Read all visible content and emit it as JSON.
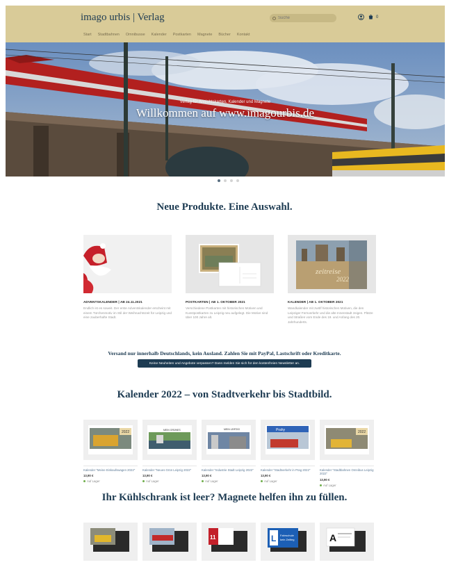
{
  "header": {
    "brand": "imago urbis | Verlag",
    "search_placeholder": "Suche",
    "user_icon": "user-icon",
    "cart_icon": "cart-icon",
    "cart_count": "0",
    "nav": [
      "Start",
      "Stadtbahnen",
      "Omnibusse",
      "Kalender",
      "Postkarten",
      "Magnete",
      "Bücher",
      "Kontakt"
    ]
  },
  "hero": {
    "subtitle": "Verlag für Ansichtskarten, Kalender und Magnete",
    "title": "Willkommen auf www.imagourbis.de",
    "slides": 4,
    "active_slide": 1
  },
  "sections": {
    "products_title": "Neue Produkte. Eine Auswahl.",
    "calendars_title": "Kalender 2022 – von Stadtverkehr bis Stadtbild.",
    "magnets_title": "Ihr Kühlschrank ist leer? Magnete helfen ihn zu füllen."
  },
  "teasers": [
    {
      "caption": "ADVENTSKALENDER | AB 24.11.2021",
      "text": "Endlich ist es soweit. Der erste Adventskalender erscheint mit einem Türchenmotiv im Stil der Weihnachtszeit für Leipzig und eine zauberhafte Stadt."
    },
    {
      "caption": "POSTKARTEN | AB 1. OKTOBER 2021",
      "text": "Verschiedene Postkarten mit historischen Motiven und Kunstpostkarten zu Leipzig neu aufgelegt. Die Motive sind über 100 Jahre alt."
    },
    {
      "caption": "KALENDER | AB 1. OKTOBER 2021",
      "text": "Wandkalender mit zwölf historischen Motiven, die den Leipziger Fernverkehr und die alte Innenstadt zeigen. Plätze und Straßen vom Ende des 19. und Anfang des 20. Jahrhunderts."
    }
  ],
  "shipping_note": "Versand nur innerhalb Deutschlands, kein Ausland. Zahlen Sie mit PayPal, Lastschrift oder Kreditkarte.",
  "newsletter_button": "Keine Neuheiten und Angebote verpassen? Dann melden Sie sich für den kostenfreien Newsletter an.",
  "calendars": [
    {
      "name": "Kalender \"Meine Einkaufswagen 2022\"",
      "price": "13,90 €",
      "stock": "Auf Lager"
    },
    {
      "name": "Kalender \"Neues Grün Leipzig 2022\"",
      "price": "13,90 €",
      "stock": "Auf Lager"
    },
    {
      "name": "Kalender \"Industrie Stadt Leipzig 2022\"",
      "price": "13,90 €",
      "stock": "Auf Lager"
    },
    {
      "name": "Kalender \"Stadtverkehr in Prag 2022\"",
      "price": "13,90 €",
      "stock": "Auf Lager"
    },
    {
      "name": "Kalender \"Stadtbahnen Omnibus Leipzig 2022\"",
      "price": "13,90 €",
      "stock": "Auf Lager"
    }
  ],
  "image_texts": {
    "calendar_badge": "2022",
    "teaser_calendar_word": "zeitreise",
    "teaser_calendar_year": "2022",
    "calendar_card_2": "MEIN GRÜNES",
    "calendar_card_3": "MEIN LEIPZIG",
    "calendar_card_4": "Prahy",
    "magnet_3_number": "11",
    "magnet_4_line1": "Fahrschule",
    "magnet_4_line2": "kein Zeitleg",
    "magnet_5_letter": "A"
  },
  "colors": {
    "header_bg": "#d9cb98",
    "brand_navy": "#1d3b52",
    "stock_green": "#6fae4b"
  }
}
